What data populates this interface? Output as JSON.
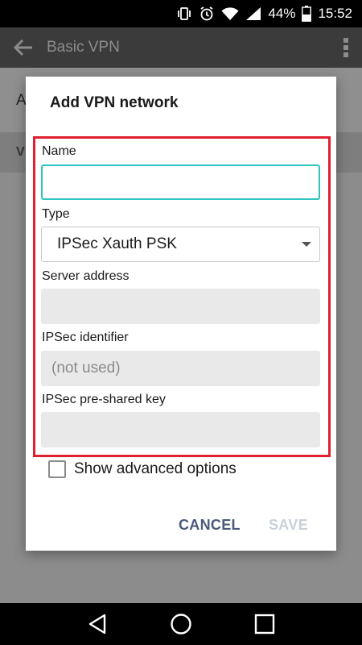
{
  "status_bar": {
    "battery_percent": "44%",
    "time": "15:52",
    "icons": [
      "vibrate-icon",
      "alarm-icon",
      "wifi-icon",
      "signal-icon",
      "battery-icon"
    ]
  },
  "app_bar": {
    "title": "Basic VPN",
    "icons": [
      "back-arrow-icon",
      "overflow-menu-icon"
    ]
  },
  "background": {
    "row1_text": "A",
    "row2_text": "V"
  },
  "dialog": {
    "title": "Add VPN network",
    "fields": {
      "name": {
        "label": "Name",
        "value": ""
      },
      "type": {
        "label": "Type",
        "value": "IPSec Xauth PSK"
      },
      "server_address": {
        "label": "Server address",
        "value": ""
      },
      "ipsec_identifier": {
        "label": "IPSec identifier",
        "placeholder": "(not used)"
      },
      "ipsec_psk": {
        "label": "IPSec pre-shared key",
        "value": ""
      }
    },
    "show_advanced": {
      "label": "Show advanced options",
      "checked": false
    },
    "buttons": {
      "cancel": "CANCEL",
      "save": "SAVE"
    }
  },
  "nav_bar": {
    "icons": [
      "back-triangle-icon",
      "home-circle-icon",
      "recents-square-icon"
    ]
  },
  "colors": {
    "accent": "#2ec4c0",
    "highlight": "#e0202e",
    "button_text": "#4a5a7a",
    "disabled_button": "#c9d0da"
  }
}
